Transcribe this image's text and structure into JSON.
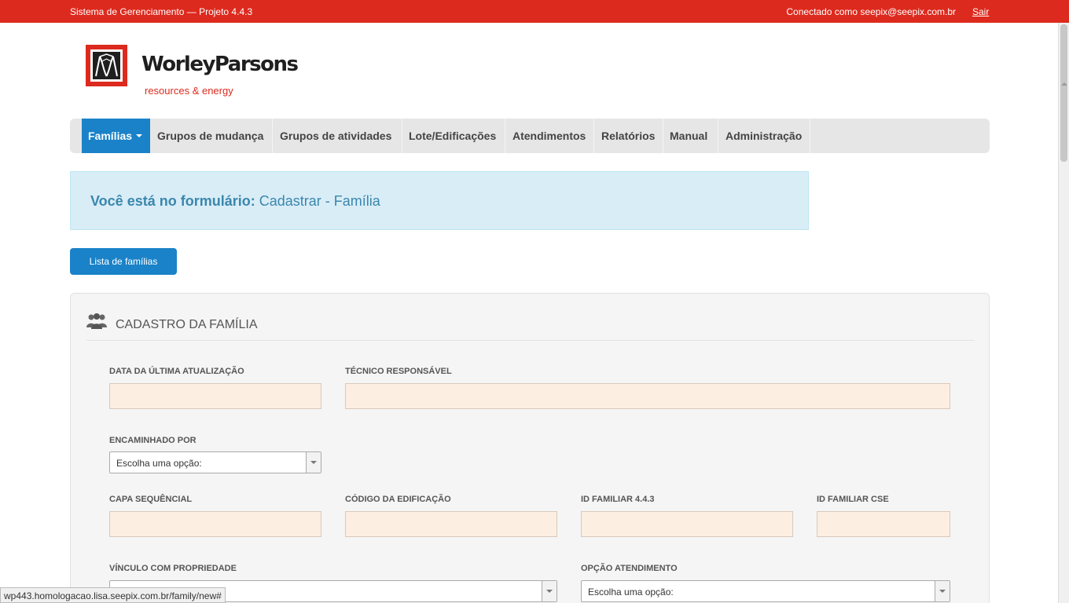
{
  "topbar": {
    "system_title": "Sistema de Gerenciamento — Projeto 4.4.3",
    "connected": "Conectado como seepix@seepix.com.br",
    "logout": "Sair",
    "color": "#dd2a1e"
  },
  "brand": {
    "name": "WorleyParsons",
    "tagline": "resources & energy"
  },
  "nav": {
    "items": [
      {
        "label": "Famílias"
      },
      {
        "label": "Grupos de mudança"
      },
      {
        "label": "Grupos de atividades"
      },
      {
        "label": "Lote/Edificações"
      },
      {
        "label": "Atendimentos"
      },
      {
        "label": "Relatórios"
      },
      {
        "label": "Manual"
      },
      {
        "label": "Administração"
      }
    ],
    "active_color": "#1a82c8"
  },
  "alert": {
    "prefix": "Você está no formulário:",
    "form": "Cadastrar - Família"
  },
  "actions": {
    "list_button": "Lista de famílias"
  },
  "panel": {
    "title": "CADASTRO DA FAMÍLIA",
    "icon": "users-icon",
    "fields": {
      "last_update": {
        "label": "DATA DA ÚLTIMA ATUALIZAÇÃO",
        "value": ""
      },
      "technician": {
        "label": "TÉCNICO RESPONSÁVEL",
        "value": ""
      },
      "referred_by": {
        "label": "ENCAMINHADO POR",
        "selected": "Escolha uma opção:"
      },
      "capa_seq": {
        "label": "CAPA SEQUÊNCIAL",
        "value": ""
      },
      "building_code": {
        "label": "CÓDIGO DA EDIFICAÇÃO",
        "value": ""
      },
      "family_id_443": {
        "label": "ID FAMILIAR 4.4.3",
        "value": ""
      },
      "family_id_cse": {
        "label": "ID FAMILIAR CSE",
        "value": ""
      },
      "property_link": {
        "label": "VÍNCULO COM PROPRIEDADE",
        "selected": ""
      },
      "service_option": {
        "label": "OPÇÃO ATENDIMENTO",
        "selected": "Escolha uma opção:"
      }
    }
  },
  "statusbar": {
    "url": "wp443.homologacao.lisa.seepix.com.br/family/new#"
  }
}
